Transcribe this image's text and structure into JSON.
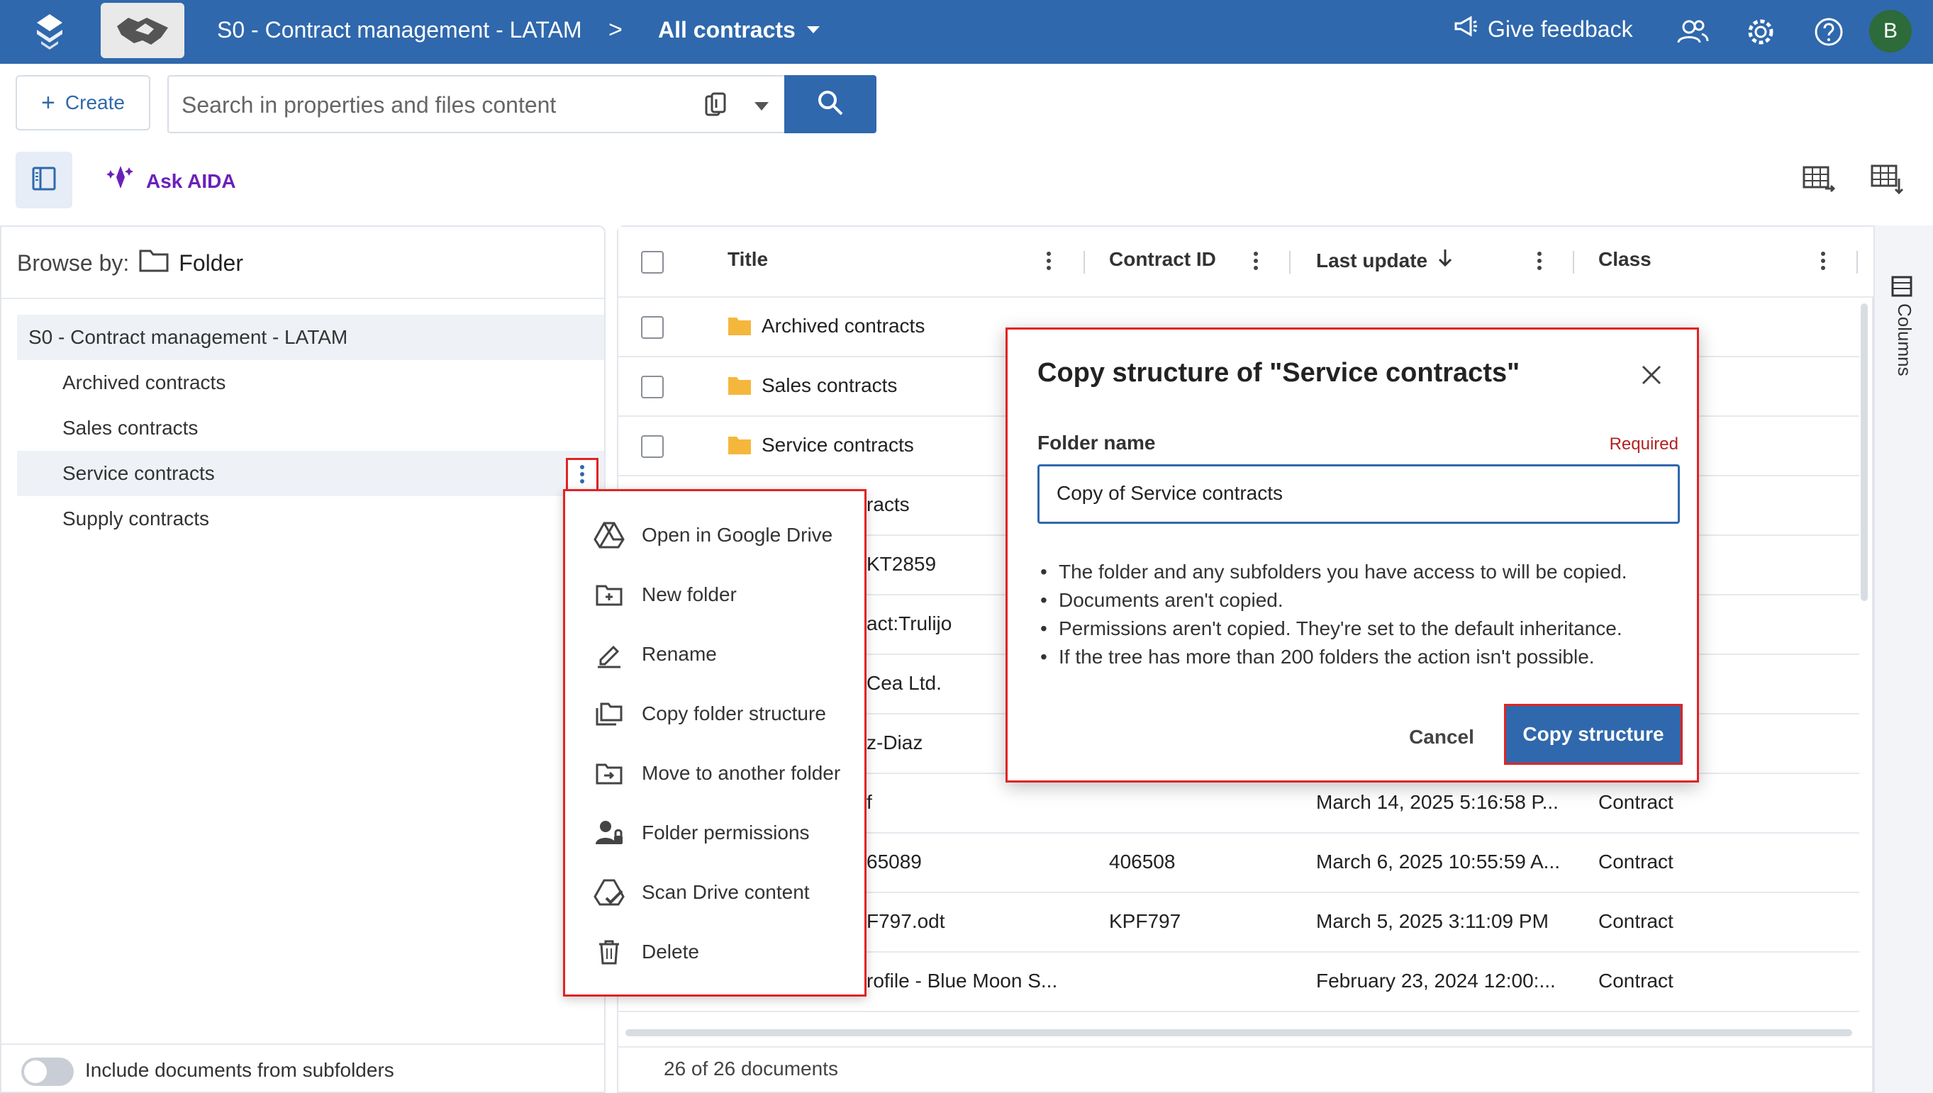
{
  "header": {
    "repo_title": "S0 - Contract management - LATAM",
    "separator": ">",
    "view_title": "All contracts",
    "give_feedback": "Give feedback",
    "avatar_initial": "B"
  },
  "toolbar": {
    "create_label": "Create",
    "search_placeholder": "Search in properties and files content",
    "ask_aida": "Ask AIDA"
  },
  "browse": {
    "label": "Browse by:",
    "value": "Folder"
  },
  "tree": {
    "root": "S0 - Contract management - LATAM",
    "items": [
      "Archived contracts",
      "Sales contracts",
      "Service contracts",
      "Supply contracts"
    ]
  },
  "subfolders_toggle": "Include documents from subfolders",
  "context_menu": {
    "items": [
      {
        "label": "Open in Google Drive",
        "icon": "google-drive-icon"
      },
      {
        "label": "New folder",
        "icon": "new-folder-icon"
      },
      {
        "label": "Rename",
        "icon": "rename-icon"
      },
      {
        "label": "Copy folder structure",
        "icon": "copy-structure-icon"
      },
      {
        "label": "Move to another folder",
        "icon": "move-folder-icon"
      },
      {
        "label": "Folder permissions",
        "icon": "permissions-icon"
      },
      {
        "label": "Scan Drive content",
        "icon": "scan-drive-icon"
      },
      {
        "label": "Delete",
        "icon": "trash-icon"
      }
    ]
  },
  "table": {
    "columns": [
      "Title",
      "Contract ID",
      "Last update",
      "Class"
    ],
    "rows": [
      {
        "title": "Archived contracts",
        "contract_id": "",
        "last_update": "",
        "class": ""
      },
      {
        "title": "Sales contracts",
        "contract_id": "",
        "last_update": "",
        "class": ""
      },
      {
        "title": "Service contracts",
        "contract_id": "",
        "last_update": "",
        "class": ""
      },
      {
        "title": "racts",
        "contract_id": "",
        "last_update": "",
        "class": ""
      },
      {
        "title": "KT2859",
        "contract_id": "",
        "last_update": "",
        "class": ""
      },
      {
        "title": "act:Trulijo",
        "contract_id": "",
        "last_update": "",
        "class": ""
      },
      {
        "title": "Cea Ltd.",
        "contract_id": "",
        "last_update": "",
        "class": ""
      },
      {
        "title": "z-Diaz",
        "contract_id": "",
        "last_update": "",
        "class": ""
      },
      {
        "title": "f",
        "contract_id": "",
        "last_update": "March 14, 2025 5:16:58 P...",
        "class": "Contract"
      },
      {
        "title": "65089",
        "contract_id": "406508",
        "last_update": "March 6, 2025 10:55:59 A...",
        "class": "Contract"
      },
      {
        "title": "F797.odt",
        "contract_id": "KPF797",
        "last_update": "March 5, 2025 3:11:09 PM",
        "class": "Contract"
      },
      {
        "title": "rofile - Blue Moon S...",
        "contract_id": "",
        "last_update": "February 23, 2024 12:00:...",
        "class": "Contract"
      }
    ],
    "count": "26 of 26 documents",
    "columns_sidebar": "Columns"
  },
  "dialog": {
    "title": "Copy structure of \"Service contracts\"",
    "field_label": "Folder name",
    "required": "Required",
    "field_value": "Copy of Service contracts",
    "notes": [
      "The folder and any subfolders you have access to will be copied.",
      "Documents aren't copied.",
      "Permissions aren't copied. They're set to the default inheritance.",
      "If the tree has more than 200 folders the action isn't possible."
    ],
    "cancel": "Cancel",
    "confirm": "Copy structure"
  },
  "colors": {
    "brand": "#2f68ac",
    "highlight": "#e02424",
    "aida": "#6b21b8",
    "folder": "#f5b73b"
  }
}
